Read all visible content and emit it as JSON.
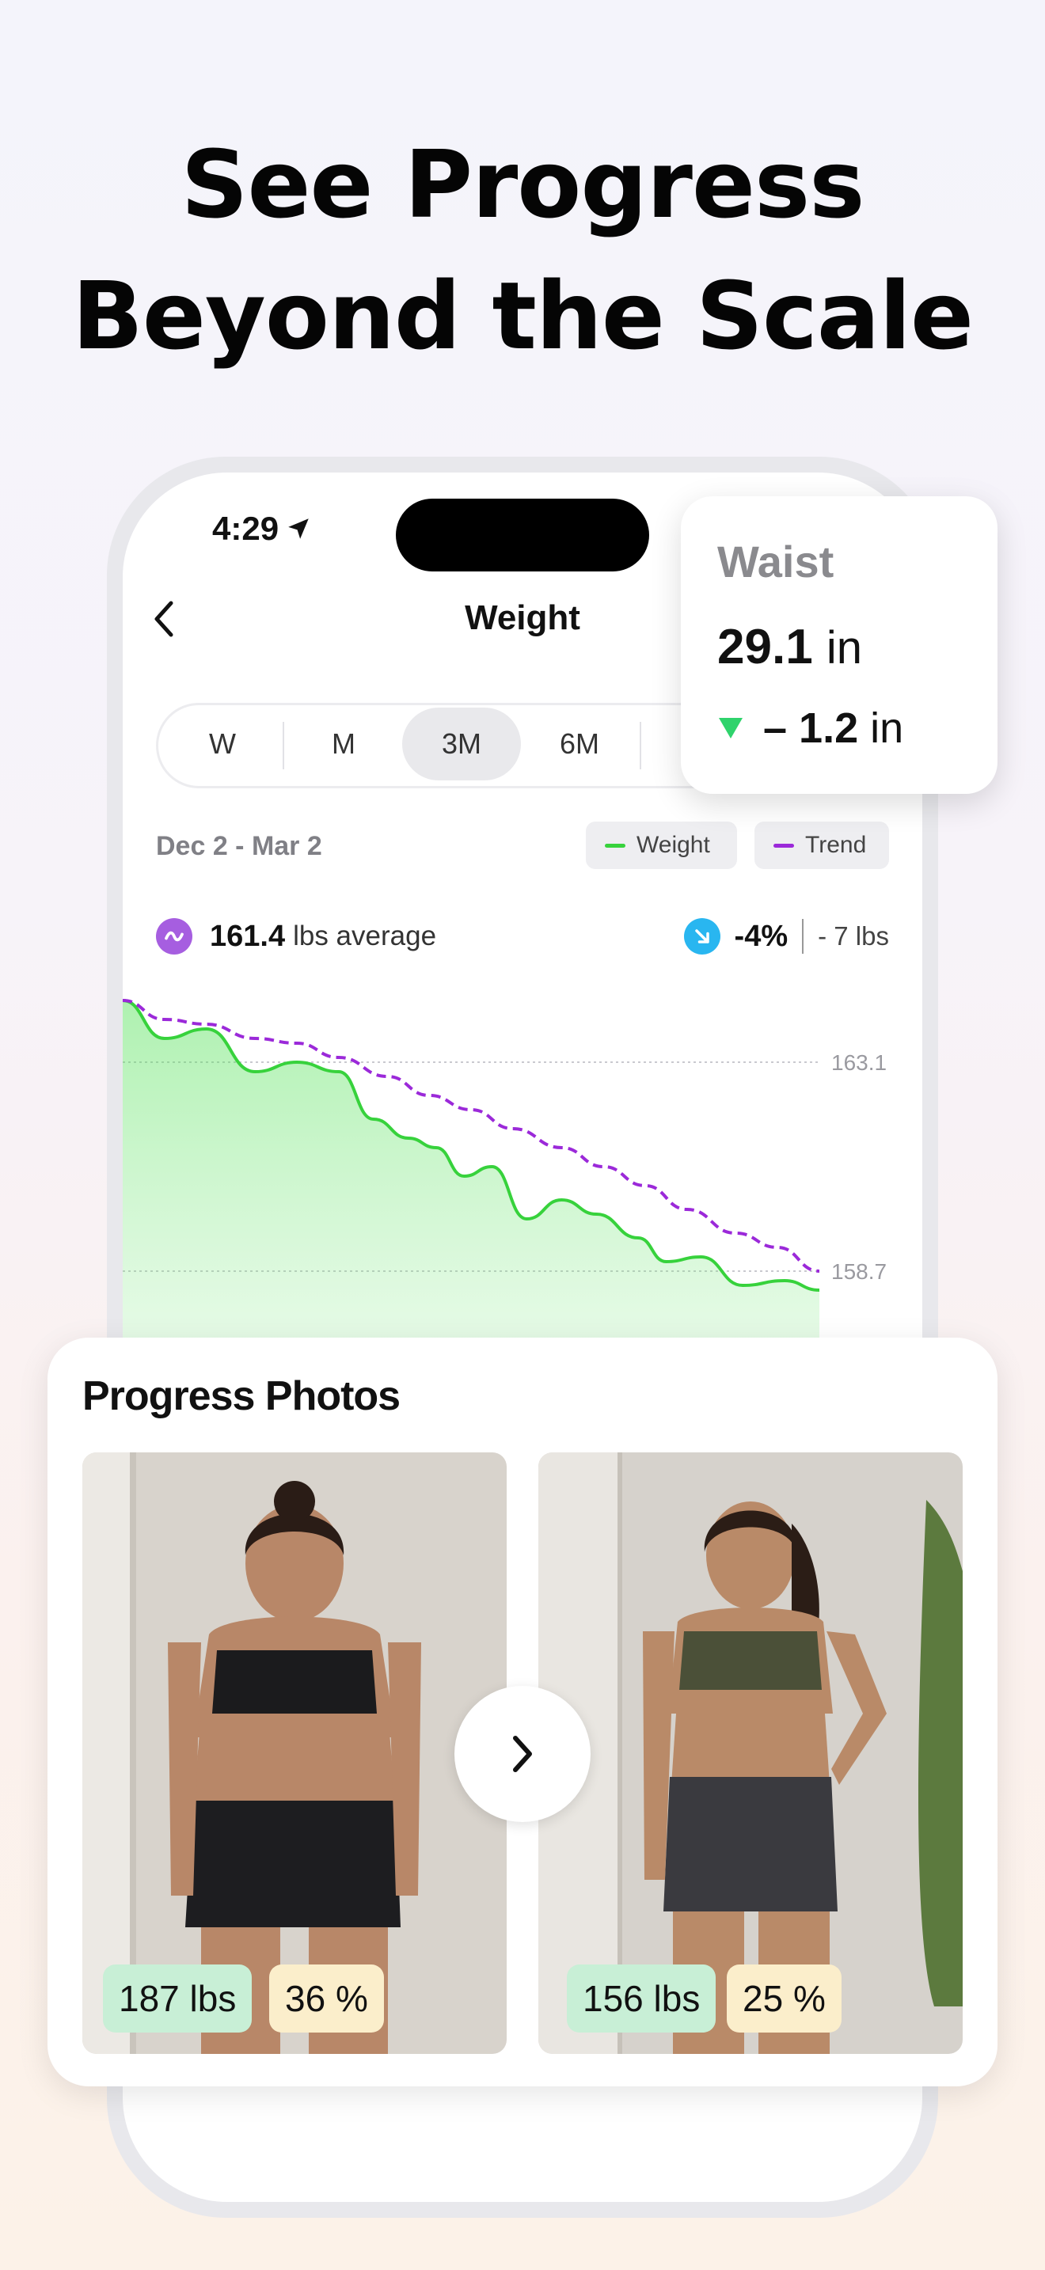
{
  "headline": {
    "line1": "See Progress",
    "line2": "Beyond the Scale"
  },
  "status_bar": {
    "time": "4:29"
  },
  "nav": {
    "title": "Weight"
  },
  "range_tabs": [
    {
      "label": "W",
      "active": false
    },
    {
      "label": "M",
      "active": false
    },
    {
      "label": "3M",
      "active": true
    },
    {
      "label": "6M",
      "active": false
    }
  ],
  "date_range": "Dec 2 - Mar 2",
  "legend": {
    "weight": "Weight",
    "trend": "Trend",
    "weight_color": "#37d23c",
    "trend_color": "#9b29d9"
  },
  "average": {
    "value": "161.4",
    "unit": "lbs average"
  },
  "change": {
    "percent": "-4%",
    "lbs": "- 7 lbs"
  },
  "waist_card": {
    "label": "Waist",
    "value": "29.1",
    "unit": "in",
    "delta": "– 1.2",
    "delta_unit": "in"
  },
  "photos": {
    "title": "Progress Photos",
    "before": {
      "weight": "187 lbs",
      "bodyfat": "36 %"
    },
    "after": {
      "weight": "156 lbs",
      "bodyfat": "25 %"
    }
  },
  "chart_data": {
    "type": "line",
    "y_ticks": [
      163.1,
      158.7
    ],
    "weight": [
      [
        0,
        164.4
      ],
      [
        0.06,
        163.6
      ],
      [
        0.12,
        163.8
      ],
      [
        0.19,
        162.9
      ],
      [
        0.25,
        163.1
      ],
      [
        0.31,
        162.9
      ],
      [
        0.36,
        161.9
      ],
      [
        0.41,
        161.5
      ],
      [
        0.45,
        161.3
      ],
      [
        0.49,
        160.7
      ],
      [
        0.53,
        160.9
      ],
      [
        0.58,
        159.8
      ],
      [
        0.63,
        160.2
      ],
      [
        0.68,
        159.9
      ],
      [
        0.74,
        159.4
      ],
      [
        0.78,
        158.9
      ],
      [
        0.83,
        159.0
      ],
      [
        0.89,
        158.4
      ],
      [
        0.95,
        158.5
      ],
      [
        1.0,
        158.3
      ]
    ],
    "trend": [
      [
        0,
        164.4
      ],
      [
        0.06,
        164.0
      ],
      [
        0.12,
        163.9
      ],
      [
        0.19,
        163.6
      ],
      [
        0.25,
        163.5
      ],
      [
        0.31,
        163.2
      ],
      [
        0.38,
        162.8
      ],
      [
        0.44,
        162.4
      ],
      [
        0.5,
        162.1
      ],
      [
        0.56,
        161.7
      ],
      [
        0.63,
        161.3
      ],
      [
        0.69,
        160.9
      ],
      [
        0.75,
        160.5
      ],
      [
        0.81,
        160.0
      ],
      [
        0.88,
        159.5
      ],
      [
        0.94,
        159.2
      ],
      [
        1.0,
        158.7
      ]
    ]
  }
}
